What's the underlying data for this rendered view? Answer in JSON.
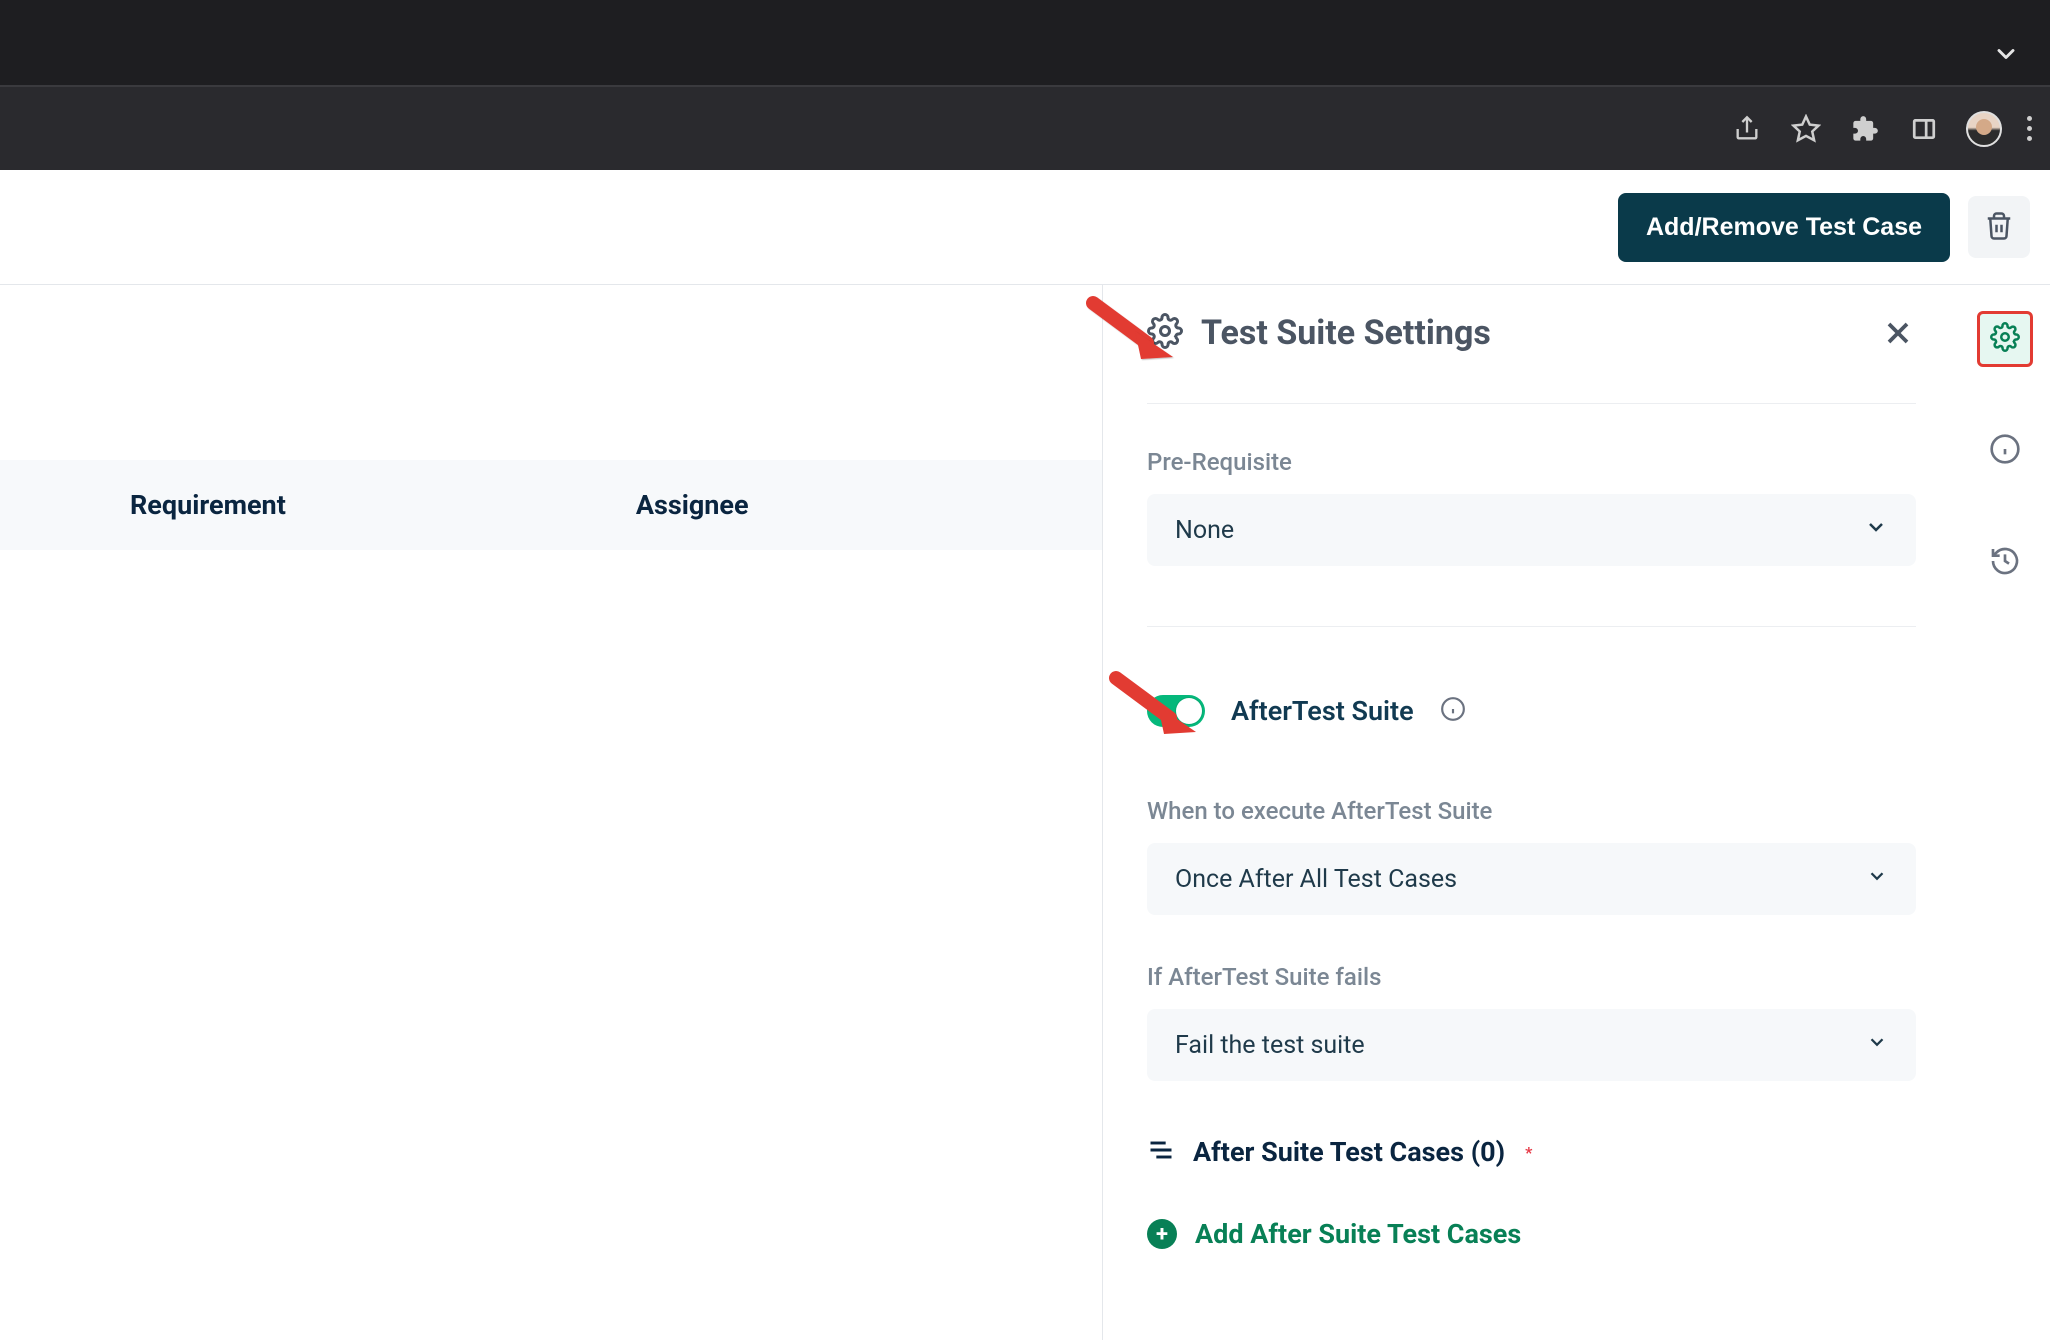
{
  "action_bar": {
    "primary_button": "Add/Remove Test Case"
  },
  "table": {
    "col1": "Requirement",
    "col2": "Assignee"
  },
  "panel": {
    "title": "Test Suite Settings",
    "prerequisite_label": "Pre-Requisite",
    "prerequisite_value": "None",
    "aftertest_toggle_label": "AfterTest Suite",
    "aftertest_toggle_on": true,
    "when_label": "When to execute AfterTest Suite",
    "when_value": "Once After All Test Cases",
    "fail_label": "If AfterTest Suite fails",
    "fail_value": "Fail the test suite",
    "cases_label": "After Suite Test Cases (0)",
    "cases_required": "*",
    "add_label": "Add After Suite Test Cases"
  }
}
